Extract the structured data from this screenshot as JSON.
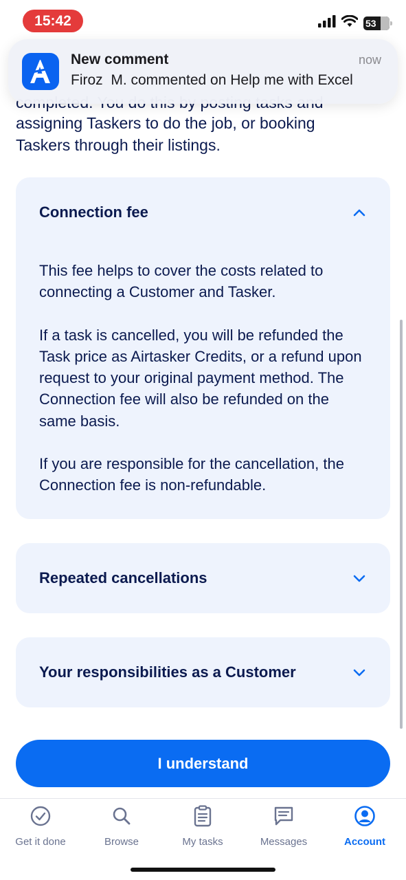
{
  "status_bar": {
    "time": "15:42",
    "battery": "53",
    "icons": [
      "signal-icon",
      "wifi-icon",
      "battery-icon"
    ]
  },
  "notification": {
    "app_icon": "airtasker-app-icon",
    "title": "New comment",
    "time": "now",
    "body": "Firoz  M. commented on Help me with Excel"
  },
  "intro": {
    "line_partial": "completed. You do this by posting tasks and",
    "line2": "assigning Taskers to do the job, or booking",
    "line3": "Taskers through their listings."
  },
  "accordions": [
    {
      "title": "Connection fee",
      "expanded": true,
      "paragraphs": [
        "This fee helps to cover the costs related to connecting a Customer and Tasker.",
        "If a task is cancelled, you will be refunded the Task price as Airtasker Credits, or a refund upon request to your original payment method. The Connection fee will also be refunded on the same basis.",
        "If you are responsible for the cancellation, the Connection fee is non-refundable."
      ]
    },
    {
      "title": "Repeated cancellations",
      "expanded": false
    },
    {
      "title": "Your responsibilities as a Customer",
      "expanded": false
    }
  ],
  "cta": {
    "label": "I understand"
  },
  "nav": {
    "items": [
      {
        "label": "Get it done",
        "icon": "check-circle-icon",
        "active": false
      },
      {
        "label": "Browse",
        "icon": "search-icon",
        "active": false
      },
      {
        "label": "My tasks",
        "icon": "clipboard-icon",
        "active": false
      },
      {
        "label": "Messages",
        "icon": "message-icon",
        "active": false
      },
      {
        "label": "Account",
        "icon": "account-icon",
        "active": true
      }
    ]
  },
  "colors": {
    "accent": "#0a6cf2",
    "text": "#0b1a4f",
    "card_bg": "#eef3fd",
    "time_pill": "#e43b3b"
  }
}
